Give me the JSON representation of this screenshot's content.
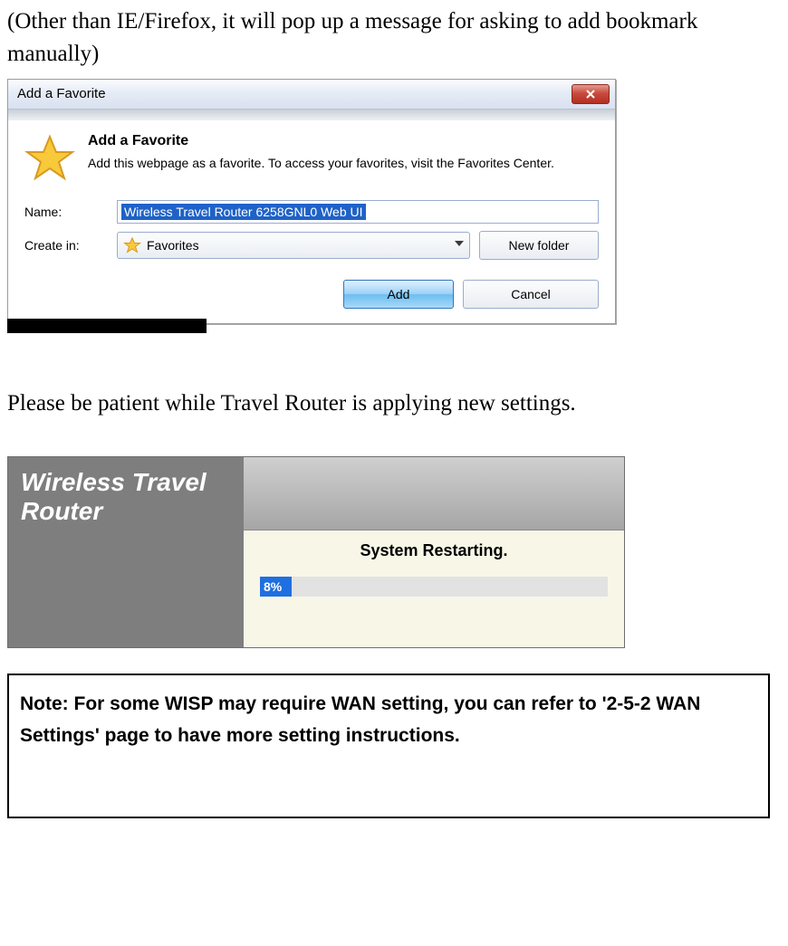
{
  "intro_text": "(Other than IE/Firefox, it will pop up a message for asking to add bookmark manually)",
  "dialog": {
    "title": "Add a Favorite",
    "headline": "Add a Favorite",
    "description": "Add this webpage as a favorite. To access your favorites, visit the Favorites Center.",
    "name_label": "Name:",
    "name_value": "Wireless Travel Router 6258GNL0 Web UI",
    "createin_label": "Create in:",
    "createin_value": "Favorites",
    "newfolder_label": "New folder",
    "add_label": "Add",
    "cancel_label": "Cancel"
  },
  "patience_text": "Please be patient while Travel Router is applying new settings.",
  "restart": {
    "brand_line1": "Wireless Travel",
    "brand_line2": "Router",
    "message": "System Restarting.",
    "progress_text": "8%",
    "progress_pct": 8
  },
  "note_text": "Note: For some WISP may require WAN setting, you can refer to '2-5-2 WAN Settings' page to have more setting instructions."
}
